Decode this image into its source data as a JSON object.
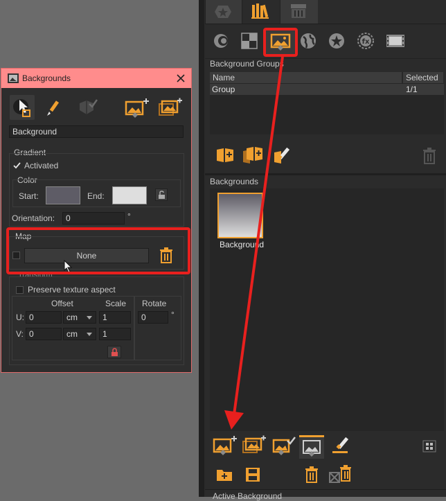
{
  "dialog": {
    "title": "Backgrounds",
    "close_icon": "close-icon",
    "name_value": "Background",
    "gradient": {
      "label": "Gradient",
      "activated_label": "Activated",
      "color_label": "Color",
      "start_label": "Start:",
      "end_label": "End:",
      "start_color": "#5e5c66",
      "end_color": "#dedede",
      "orientation_label": "Orientation:",
      "orientation_value": "0",
      "orientation_unit": "°"
    },
    "map": {
      "label": "Map",
      "none_label": "None"
    },
    "transform": {
      "label": "Transform",
      "preserve_label": "Preserve texture aspect",
      "offset_label": "Offset",
      "scale_label": "Scale",
      "rotate_label": "Rotate",
      "u_label": "U:",
      "v_label": "V:",
      "u_offset": "0",
      "v_offset": "0",
      "unit": "cm",
      "u_scale": "1",
      "v_scale": "1",
      "rotate_value": "0",
      "rotate_unit": "°"
    }
  },
  "panel": {
    "background_groups": {
      "title": "Background Groups",
      "columns": [
        "Name",
        "Selected"
      ],
      "rows": [
        {
          "name": "Group",
          "selected": "1/1"
        }
      ]
    },
    "backgrounds": {
      "title": "Backgrounds",
      "item_label": "Background"
    },
    "active_background_label": "Active Background"
  },
  "colors": {
    "accent": "#f0a030",
    "highlight": "#e8201e",
    "dialog_title_bg": "#ff8c8c"
  }
}
